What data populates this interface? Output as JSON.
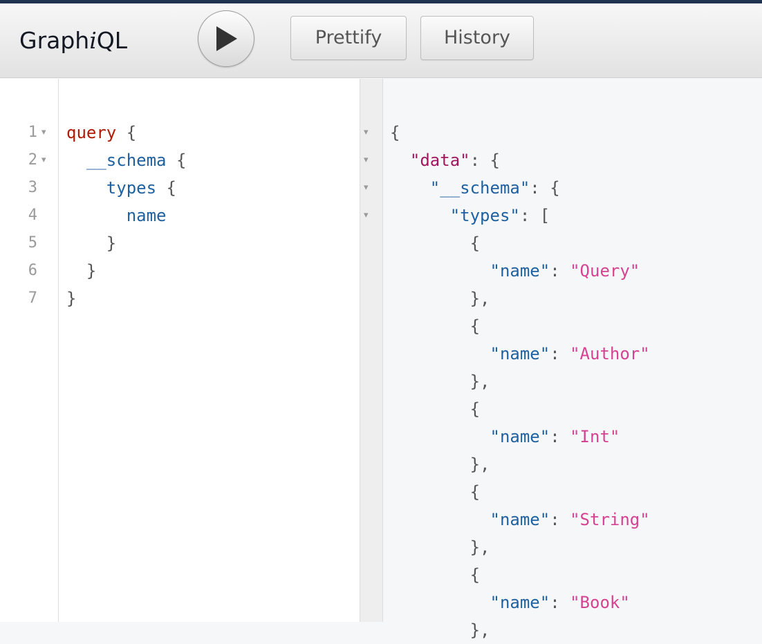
{
  "header": {
    "title_prefix": "Graph",
    "title_italic": "i",
    "title_suffix": "QL",
    "run_icon": "play-icon",
    "prettify_label": "Prettify",
    "history_label": "History"
  },
  "query_editor": {
    "line_numbers": [
      "1",
      "2",
      "3",
      "4",
      "5",
      "6",
      "7"
    ],
    "lines": [
      {
        "segments": [
          {
            "t": "query",
            "c": "kw"
          },
          {
            "t": " {",
            "c": "punct"
          }
        ]
      },
      {
        "segments": [
          {
            "t": "  __schema",
            "c": "field"
          },
          {
            "t": " {",
            "c": "punct"
          }
        ]
      },
      {
        "segments": [
          {
            "t": "    types",
            "c": "field"
          },
          {
            "t": " {",
            "c": "punct"
          }
        ]
      },
      {
        "segments": [
          {
            "t": "      name",
            "c": "field"
          }
        ]
      },
      {
        "segments": [
          {
            "t": "    }",
            "c": "punct"
          }
        ]
      },
      {
        "segments": [
          {
            "t": "  }",
            "c": "punct"
          }
        ]
      },
      {
        "segments": [
          {
            "t": "}",
            "c": "punct"
          }
        ]
      }
    ]
  },
  "result": {
    "lines": [
      {
        "segments": [
          {
            "t": "{",
            "c": "punct"
          }
        ]
      },
      {
        "segments": [
          {
            "t": "  ",
            "c": "punct"
          },
          {
            "t": "\"data\"",
            "c": "key"
          },
          {
            "t": ": {",
            "c": "punct"
          }
        ]
      },
      {
        "segments": [
          {
            "t": "    ",
            "c": "punct"
          },
          {
            "t": "\"__schema\"",
            "c": "def"
          },
          {
            "t": ": {",
            "c": "punct"
          }
        ]
      },
      {
        "segments": [
          {
            "t": "      ",
            "c": "punct"
          },
          {
            "t": "\"types\"",
            "c": "def"
          },
          {
            "t": ": [",
            "c": "punct"
          }
        ]
      },
      {
        "segments": [
          {
            "t": "        {",
            "c": "punct"
          }
        ]
      },
      {
        "segments": [
          {
            "t": "          ",
            "c": "punct"
          },
          {
            "t": "\"name\"",
            "c": "def"
          },
          {
            "t": ": ",
            "c": "punct"
          },
          {
            "t": "\"Query\"",
            "c": "str"
          }
        ]
      },
      {
        "segments": [
          {
            "t": "        },",
            "c": "punct"
          }
        ]
      },
      {
        "segments": [
          {
            "t": "        {",
            "c": "punct"
          }
        ]
      },
      {
        "segments": [
          {
            "t": "          ",
            "c": "punct"
          },
          {
            "t": "\"name\"",
            "c": "def"
          },
          {
            "t": ": ",
            "c": "punct"
          },
          {
            "t": "\"Author\"",
            "c": "str"
          }
        ]
      },
      {
        "segments": [
          {
            "t": "        },",
            "c": "punct"
          }
        ]
      },
      {
        "segments": [
          {
            "t": "        {",
            "c": "punct"
          }
        ]
      },
      {
        "segments": [
          {
            "t": "          ",
            "c": "punct"
          },
          {
            "t": "\"name\"",
            "c": "def"
          },
          {
            "t": ": ",
            "c": "punct"
          },
          {
            "t": "\"Int\"",
            "c": "str"
          }
        ]
      },
      {
        "segments": [
          {
            "t": "        },",
            "c": "punct"
          }
        ]
      },
      {
        "segments": [
          {
            "t": "        {",
            "c": "punct"
          }
        ]
      },
      {
        "segments": [
          {
            "t": "          ",
            "c": "punct"
          },
          {
            "t": "\"name\"",
            "c": "def"
          },
          {
            "t": ": ",
            "c": "punct"
          },
          {
            "t": "\"String\"",
            "c": "str"
          }
        ]
      },
      {
        "segments": [
          {
            "t": "        },",
            "c": "punct"
          }
        ]
      },
      {
        "segments": [
          {
            "t": "        {",
            "c": "punct"
          }
        ]
      },
      {
        "segments": [
          {
            "t": "          ",
            "c": "punct"
          },
          {
            "t": "\"name\"",
            "c": "def"
          },
          {
            "t": ": ",
            "c": "punct"
          },
          {
            "t": "\"Book\"",
            "c": "str"
          }
        ]
      },
      {
        "segments": [
          {
            "t": "        },",
            "c": "punct"
          }
        ]
      }
    ]
  },
  "colors": {
    "keyword": "#b11a04",
    "field": "#1f61a0",
    "data_key": "#a11760",
    "string": "#d64292",
    "punctuation": "#555555"
  }
}
